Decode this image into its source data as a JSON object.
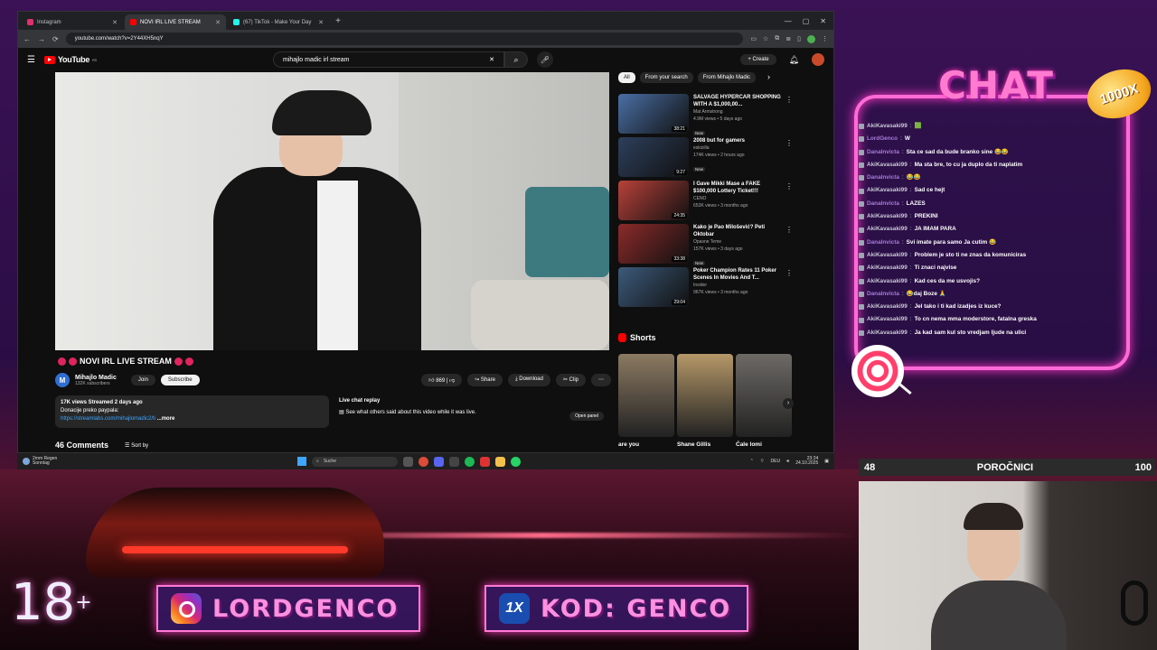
{
  "browser": {
    "tabs": [
      {
        "label": "Instagram",
        "color": "#e1306c",
        "active": false
      },
      {
        "label": "NOVI IRL LIVE STREAM",
        "color": "#ff0000",
        "active": true
      },
      {
        "label": "(67) TikTok - Make Your Day",
        "color": "#25f4ee",
        "active": false
      }
    ],
    "url": "youtube.com/watch?v=2Y44XH5nqY"
  },
  "youtube": {
    "logo": "YouTube",
    "logo_region": "RS",
    "search_value": "mihajlo madic irl stream",
    "create_label": "Create",
    "video_title": "NOVI IRL LIVE STREAM",
    "channel_name": "Mihajlo Madic",
    "channel_initial": "M",
    "subscribers": "132K subscribers",
    "join_label": "Join",
    "subscribe_label": "Subscribe",
    "likes": "869",
    "share_label": "Share",
    "download_label": "Download",
    "clip_label": "Clip",
    "description": {
      "stats": "17K views Streamed 2 days ago",
      "line1": "Donacije preko paypala:",
      "link": "https://streamlabs.com/mihajlomadic2/ti",
      "more": "...more"
    },
    "chat_replay": {
      "title": "Live chat replay",
      "text": "See what others said about this video while it was live.",
      "button": "Open panel"
    },
    "comments_count": "46 Comments",
    "sort_label": "Sort by",
    "chips": [
      "All",
      "From your search",
      "From Mihajlo Madic"
    ],
    "related": [
      {
        "title": "SALVAGE HYPERCAR SHOPPING WITH A $1,000,00...",
        "channel": "Mat Armstrong",
        "views": "4.9M views • 5 days ago",
        "badge": "New",
        "duration": "38:21",
        "color": "#4a6fa5"
      },
      {
        "title": "2008 but for gamers",
        "channel": "eskizilla",
        "views": "174K views • 2 hours ago",
        "badge": "New",
        "duration": "9:27",
        "color": "#2d3f5c"
      },
      {
        "title": "I Gave Mikki Mase a FAKE $100,000 Lottery Ticket!!!",
        "channel": "CENO",
        "views": "653K views • 3 months ago",
        "badge": "",
        "duration": "24:35",
        "color": "#b8413a"
      },
      {
        "title": "Kako je Pao Milošević? Peti Oktobar",
        "channel": "Opasne Teme",
        "views": "157K views • 3 days ago",
        "badge": "New",
        "duration": "33:38",
        "color": "#8c2a2a"
      },
      {
        "title": "Poker Champion Rates 11 Poker Scenes In Movies And T...",
        "channel": "Insider",
        "views": "967K views • 3 months ago",
        "badge": "",
        "duration": "29:04",
        "color": "#3c5a7a"
      }
    ],
    "shorts_label": "Shorts",
    "shorts": [
      {
        "title": "are you",
        "color": "#8c7a62"
      },
      {
        "title": "Shane Gillis",
        "color": "#b59868"
      },
      {
        "title": "Ćale lomi",
        "color": "#6d6a66"
      }
    ]
  },
  "taskbar": {
    "weather_temp": "2mm Regen",
    "weather_day": "Sonntag",
    "search_label": "Suche",
    "lang": "DEU",
    "time": "23:24",
    "date": "24.10.2025"
  },
  "chat": {
    "title": "CHAT",
    "sticker": "1000X",
    "messages": [
      {
        "user": "AkiKavasaki99",
        "msg": "🟩",
        "user_color": "#c9c9d6"
      },
      {
        "user": "LordGenco",
        "msg": "W",
        "user_color": "#a77bd8"
      },
      {
        "user": "Danalnvicta",
        "msg": "Sta ce sad da bude branko sine 😂😂",
        "user_color": "#a77bd8"
      },
      {
        "user": "AkiKavasaki99",
        "msg": "Ma sta bre, to cu ja duplo da ti naplatim",
        "user_color": "#c9c9d6"
      },
      {
        "user": "Danalnvicta",
        "msg": "😂😂",
        "user_color": "#a77bd8"
      },
      {
        "user": "AkiKavasaki99",
        "msg": "Sad ce hejt",
        "user_color": "#c9c9d6"
      },
      {
        "user": "Danalnvicta",
        "msg": "LAZES",
        "user_color": "#a77bd8"
      },
      {
        "user": "AkiKavasaki99",
        "msg": "PREKINI",
        "user_color": "#c9c9d6"
      },
      {
        "user": "AkiKavasaki99",
        "msg": "JA IMAM PARA",
        "user_color": "#c9c9d6"
      },
      {
        "user": "Danalnvicta",
        "msg": "Svi imate para samo Ja cutim 😂",
        "user_color": "#a77bd8"
      },
      {
        "user": "AkiKavasaki99",
        "msg": "Problem je sto ti ne znas da komuniciras",
        "user_color": "#c9c9d6"
      },
      {
        "user": "AkiKavasaki99",
        "msg": "Ti znaci najvise",
        "user_color": "#c9c9d6"
      },
      {
        "user": "AkiKavasaki99",
        "msg": "Kad ces da me usvojis?",
        "user_color": "#c9c9d6"
      },
      {
        "user": "Danalnvicta",
        "msg": "😂daj Boze 🙏",
        "user_color": "#a77bd8"
      },
      {
        "user": "AkiKavasaki99",
        "msg": "Jel tako i ti kad izadjes iz kuce?",
        "user_color": "#c9c9d6"
      },
      {
        "user": "AkiKavasaki99",
        "msg": "To cn nema mma moderstore, fatalna greska",
        "user_color": "#c9c9d6"
      },
      {
        "user": "AkiKavasaki99",
        "msg": "Ja kad sam kul sto vredjam ljude na ulici",
        "user_color": "#c9c9d6"
      }
    ]
  },
  "poll": {
    "left": "48",
    "label": "POROČNICI",
    "right": "100"
  },
  "overlay": {
    "age": "18",
    "age_plus": "+",
    "instagram": "LORDGENCO",
    "promo_logo": "1X",
    "promo": "KOD: GENCO"
  }
}
